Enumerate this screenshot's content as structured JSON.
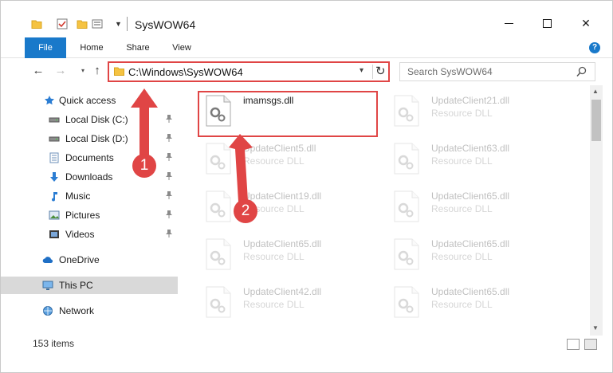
{
  "window": {
    "title": "SysWOW64",
    "controls": {
      "minimize": "minimize",
      "maximize": "maximize",
      "close": "✕"
    }
  },
  "ribbon": {
    "tabs": [
      {
        "label": "File",
        "active": true
      },
      {
        "label": "Home"
      },
      {
        "label": "Share"
      },
      {
        "label": "View"
      }
    ],
    "help": "?"
  },
  "nav": {
    "back": "←",
    "forward": "→",
    "recent": "▾",
    "up": "↑",
    "address": "C:\\Windows\\SysWOW64",
    "address_dropdown": "▾",
    "refresh": "↻",
    "search_placeholder": "Search SysWOW64"
  },
  "sidebar": {
    "items": [
      {
        "label": "Quick access",
        "icon": "star-icon",
        "pinned": false
      },
      {
        "label": "Local Disk (C:)",
        "icon": "drive-icon",
        "pinned": true
      },
      {
        "label": "Local Disk (D:)",
        "icon": "drive-icon",
        "pinned": true
      },
      {
        "label": "Documents",
        "icon": "documents-icon",
        "pinned": true
      },
      {
        "label": "Downloads",
        "icon": "download-icon",
        "pinned": true
      },
      {
        "label": "Music",
        "icon": "music-icon",
        "pinned": true
      },
      {
        "label": "Pictures",
        "icon": "pictures-icon",
        "pinned": true
      },
      {
        "label": "Videos",
        "icon": "videos-icon",
        "pinned": true
      },
      {
        "label": "OneDrive",
        "icon": "cloud-icon",
        "pinned": false
      },
      {
        "label": "This PC",
        "icon": "computer-icon",
        "pinned": false,
        "selected": true
      },
      {
        "label": "Network",
        "icon": "network-icon",
        "pinned": false
      }
    ]
  },
  "files": [
    {
      "name": "imamsgs.dll",
      "type": ""
    },
    {
      "name": "UpdateClient21.dll",
      "type": "Resource DLL"
    },
    {
      "name": "UpdateClient5.dll",
      "type": "Resource DLL"
    },
    {
      "name": "UpdateClient63.dll",
      "type": "Resource DLL"
    },
    {
      "name": "UpdateClient19.dll",
      "type": "Resource DLL"
    },
    {
      "name": "UpdateClient65.dll",
      "type": "Resource DLL"
    },
    {
      "name": "UpdateClient65.dll",
      "type": "Resource DLL"
    },
    {
      "name": "UpdateClient65.dll",
      "type": "Resource DLL"
    },
    {
      "name": "UpdateClient42.dll",
      "type": "Resource DLL"
    },
    {
      "name": "UpdateClient65.dll",
      "type": "Resource DLL"
    }
  ],
  "callouts": {
    "one": "1",
    "two": "2"
  },
  "status": {
    "count": "153 items"
  },
  "colors": {
    "accent": "#1979ca",
    "callout": "#e04545",
    "selected": "#d9d9d9"
  }
}
